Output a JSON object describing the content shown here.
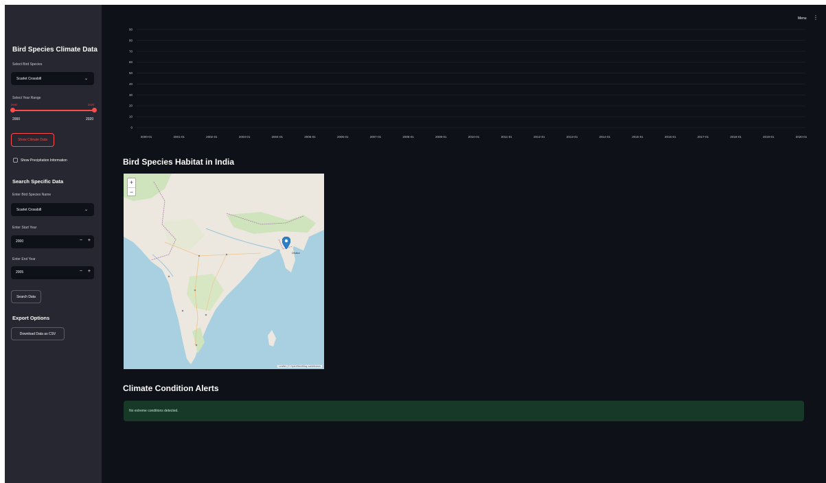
{
  "sidebar": {
    "title": "Bird Species Climate Data",
    "select_species_label": "Select Bird Species",
    "select_species_value": "Scarlet Crossbill",
    "year_range_label": "Select Year Range",
    "year_range_min_cap": "2000",
    "year_range_max_cap": "2020",
    "year_range_min": "2000",
    "year_range_max": "2020",
    "show_button": "Show Climate Data",
    "checkbox_label": "Show Precipitation Information",
    "search_heading": "Search Specific Data",
    "search_species_label": "Enter Bird Species Name",
    "search_species_value": "Scarlet Crossbill",
    "start_year_label": "Enter Start Year",
    "start_year_value": "2000",
    "end_year_label": "Enter End Year",
    "end_year_value": "2005",
    "search_button": "Search Data",
    "export_heading": "Export Options",
    "download_button": "Download Data as CSV"
  },
  "menu": {
    "label": "Menu"
  },
  "map": {
    "title": "Bird Species Habitat in India",
    "zoom_in": "+",
    "zoom_out": "−",
    "marker_label": "Dhaka",
    "attribution": "Leaflet | © OpenStreetMap contributors"
  },
  "alerts": {
    "title": "Climate Condition Alerts",
    "message": "No extreme conditions detected."
  },
  "colors": {
    "app_background": "#0e1117",
    "sidebar_background": "#262730",
    "accent_red": "#ff4b4b",
    "success_background": "#173928",
    "marker_blue": "#2a81cb"
  },
  "icons": {
    "select_chevron": "chevron-down-icon",
    "map_marker": "map-pin-icon",
    "menu": "vertical-dots-icon"
  },
  "chart_data": {
    "type": "line",
    "y_ticks": [
      "0",
      "10",
      "20",
      "30",
      "40",
      "50",
      "60",
      "70",
      "80",
      "90"
    ],
    "x_ticks": [
      "2000-01",
      "2001-01",
      "2002-01",
      "2003-01",
      "2004-01",
      "2005-01",
      "2006-01",
      "2007-01",
      "2008-01",
      "2009-01",
      "2010-01",
      "2011-01",
      "2012-01",
      "2013-01",
      "2014-01",
      "2015-01",
      "2016-01",
      "2017-01",
      "2018-01",
      "2019-01",
      "2020-01"
    ],
    "series": [],
    "grid": true
  }
}
